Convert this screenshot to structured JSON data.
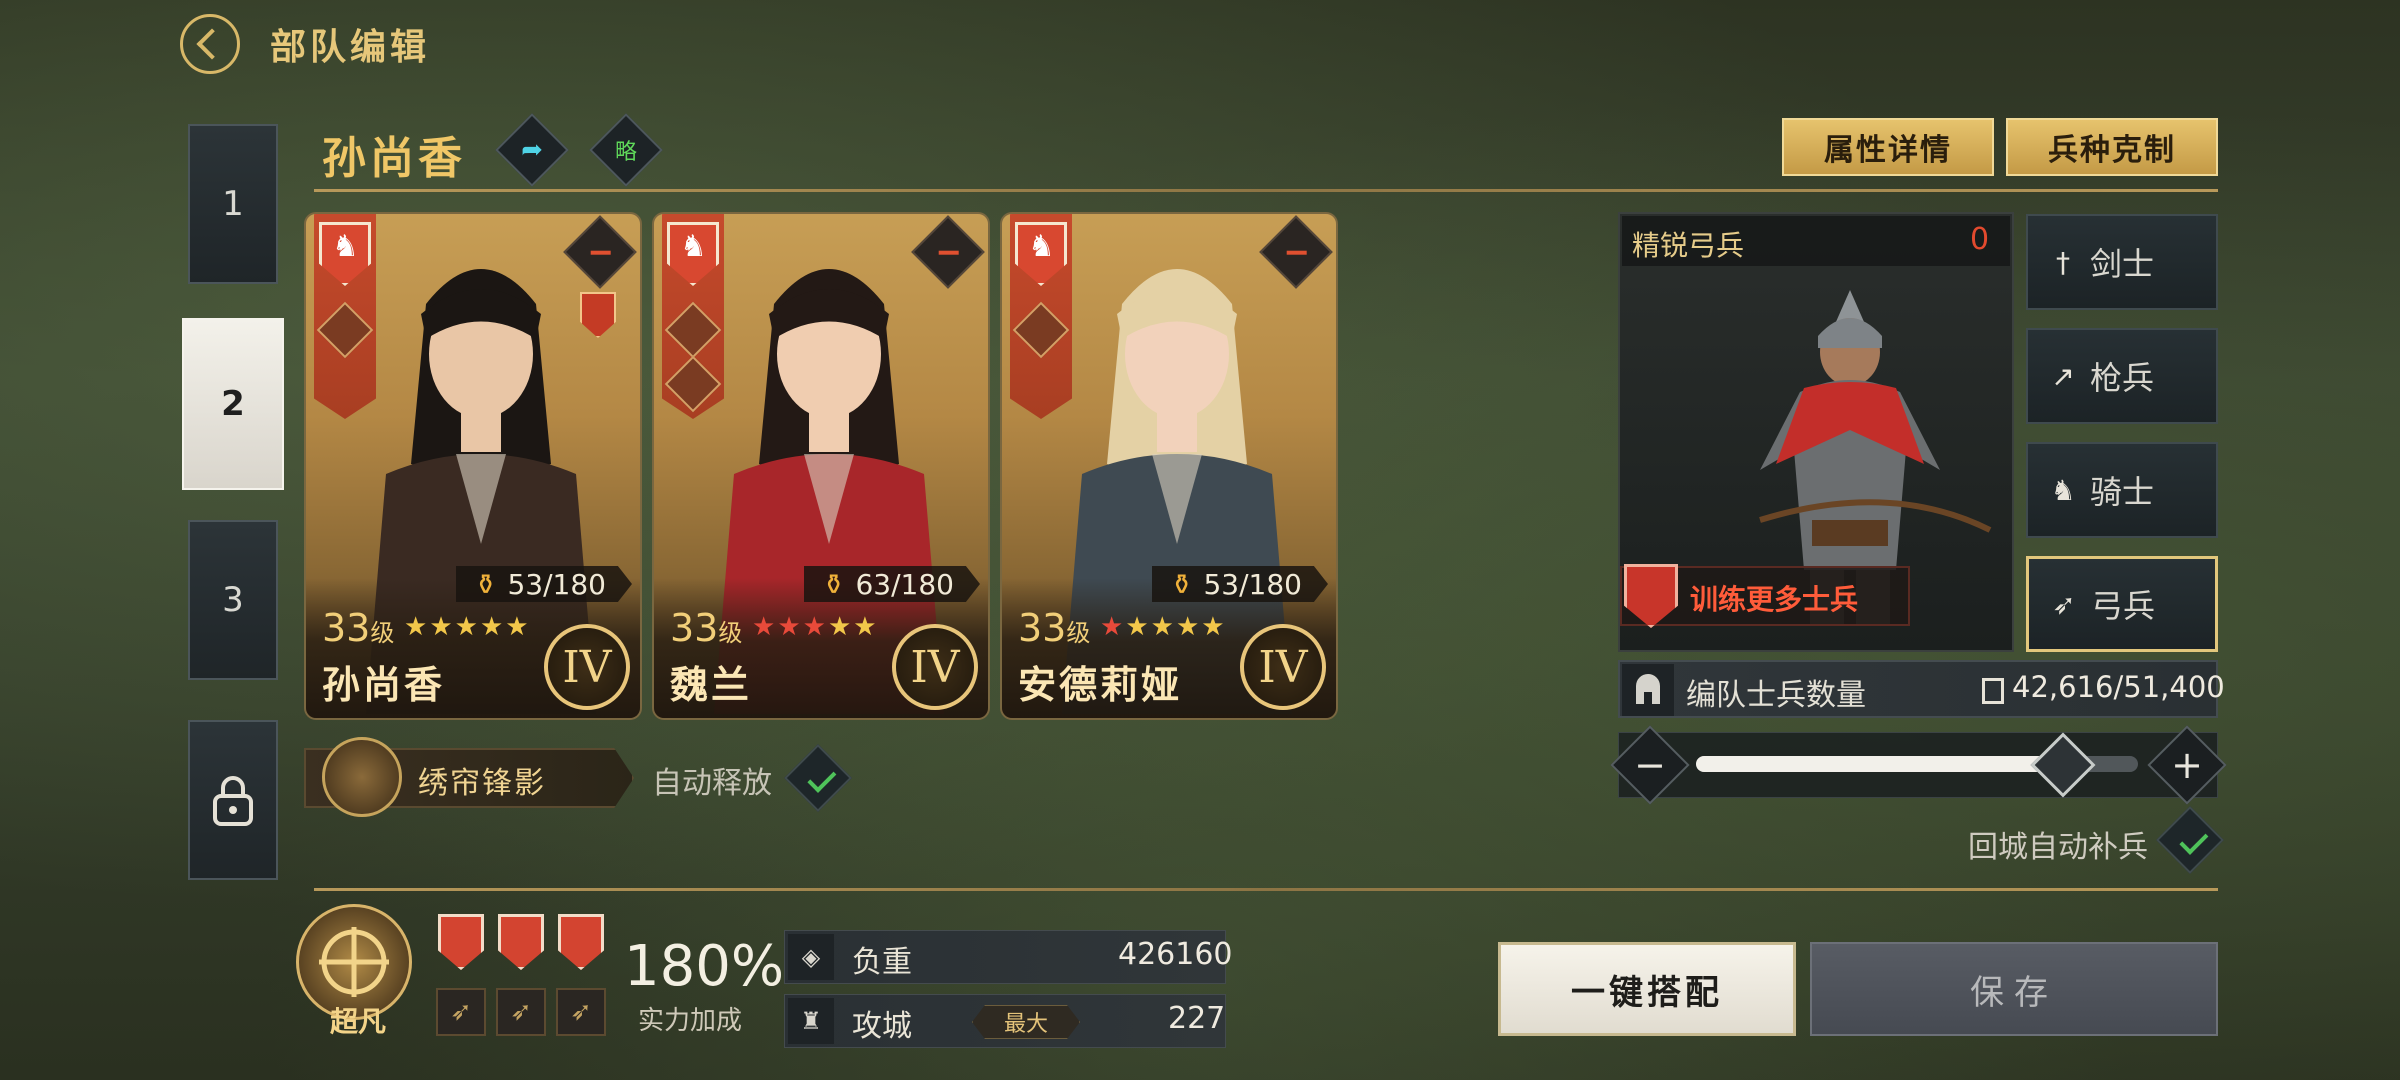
{
  "header": {
    "title": "部队编辑"
  },
  "teams": [
    "1",
    "2",
    "3"
  ],
  "hero_header": {
    "name": "孙尚香",
    "share_icon": "arrow-share-icon",
    "strategy_label": "略",
    "attr_button": "属性详情",
    "counter_button": "兵种克制"
  },
  "cards": [
    {
      "name": "孙尚香",
      "level": "33",
      "level_unit": "级",
      "troops": "53/180",
      "rank": "IV",
      "stars_filled": 5,
      "star_color": "#f2c74a"
    },
    {
      "name": "魏兰",
      "level": "33",
      "level_unit": "级",
      "troops": "63/180",
      "rank": "IV",
      "stars_filled": 3,
      "star_color": "#e84a3a"
    },
    {
      "name": "安德莉娅",
      "level": "33",
      "level_unit": "级",
      "troops": "53/180",
      "rank": "IV",
      "stars_filled": 1,
      "star_color": "#e84a3a"
    }
  ],
  "skill": {
    "name": "绣帘锋影",
    "auto_release": "自动释放"
  },
  "troop_panel": {
    "title": "精锐弓兵",
    "count": "0",
    "train_label": "训练更多士兵",
    "types": [
      {
        "label": "剑士",
        "icon": "sword-icon"
      },
      {
        "label": "枪兵",
        "icon": "spear-icon"
      },
      {
        "label": "骑士",
        "icon": "horse-icon"
      },
      {
        "label": "弓兵",
        "icon": "bow-icon"
      }
    ],
    "active_type": "弓兵"
  },
  "formation": {
    "label": "编队士兵数量",
    "value": "42,616/51,400",
    "slider_fraction": 0.83,
    "auto_replenish": "回城自动补兵"
  },
  "bottom": {
    "emblem_label": "超凡",
    "power_value": "180%",
    "power_label": "实力加成",
    "load_label": "负重",
    "load_value": "426160",
    "siege_label": "攻城",
    "siege_tag": "最大",
    "siege_value": "227",
    "match_button": "一键搭配",
    "save_button": "保存"
  },
  "colors": {
    "accent_gold": "#e6c77a",
    "danger_red": "#e24a2e",
    "check_green": "#4fc35a"
  }
}
